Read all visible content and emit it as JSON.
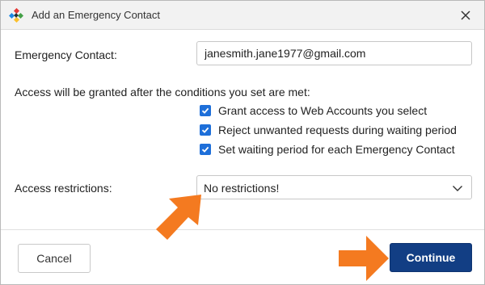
{
  "window": {
    "title": "Add an Emergency Contact",
    "icon": "app-logo-icon",
    "close_icon": "close-icon"
  },
  "form": {
    "contact_label": "Emergency Contact:",
    "contact_value": "janesmith.jane1977@gmail.com",
    "conditions_text": "Access will be granted after the conditions you set are met:",
    "conditions": [
      {
        "label": "Grant access to Web Accounts you select",
        "checked": true
      },
      {
        "label": "Reject unwanted requests during waiting period",
        "checked": true
      },
      {
        "label": "Set waiting period for each Emergency Contact",
        "checked": true
      }
    ],
    "restrictions_label": "Access restrictions:",
    "restrictions_value": "No restrictions!"
  },
  "footer": {
    "cancel_label": "Cancel",
    "continue_label": "Continue"
  },
  "colors": {
    "accent": "#1e6fd9",
    "primary_button": "#123e84",
    "annotation_arrow": "#f47a20"
  },
  "annotations": [
    {
      "name": "arrow-pointing-to-restrictions",
      "icon": "orange-arrow-icon"
    },
    {
      "name": "arrow-pointing-to-continue",
      "icon": "orange-arrow-icon"
    }
  ]
}
